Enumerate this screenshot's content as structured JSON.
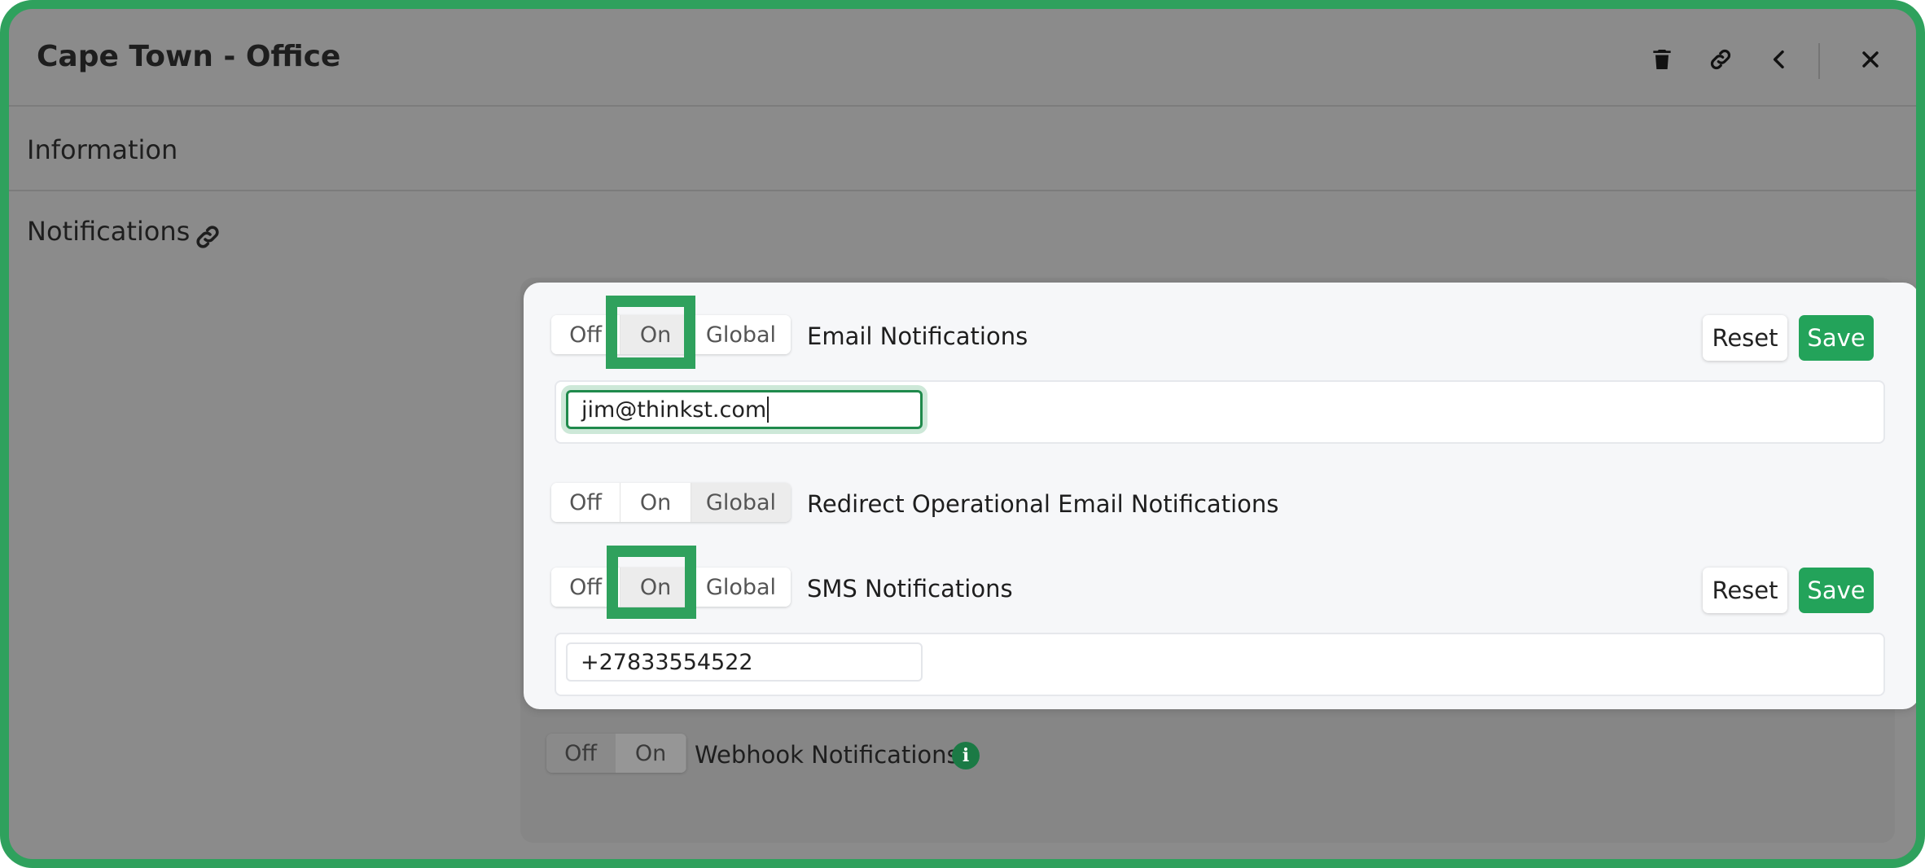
{
  "window": {
    "title": "Cape Town - Office",
    "actions": [
      {
        "name": "delete-icon",
        "icon": "trash"
      },
      {
        "name": "link-icon",
        "icon": "link"
      },
      {
        "name": "back-icon",
        "icon": "chevron-left"
      },
      {
        "name": "close-icon",
        "icon": "x"
      }
    ]
  },
  "sections": {
    "information": "Information",
    "notifications": "Notifications"
  },
  "toggle_labels": {
    "off": "Off",
    "on": "On",
    "global": "Global"
  },
  "email": {
    "label": "Email Notifications",
    "state": "On",
    "value": "jim@thinkst.com",
    "reset": "Reset",
    "save": "Save"
  },
  "redirect": {
    "label": "Redirect Operational Email Notifications",
    "state": "Global"
  },
  "sms": {
    "label": "SMS Notifications",
    "state": "On",
    "value": "+27833554522",
    "reset": "Reset",
    "save": "Save"
  },
  "webhook": {
    "label": "Webhook Notifications",
    "state": "Off",
    "info_icon": "i"
  },
  "colors": {
    "accent": "#23a35a",
    "highlight": "#2fa15d",
    "overlay": "#8b8b8b"
  }
}
